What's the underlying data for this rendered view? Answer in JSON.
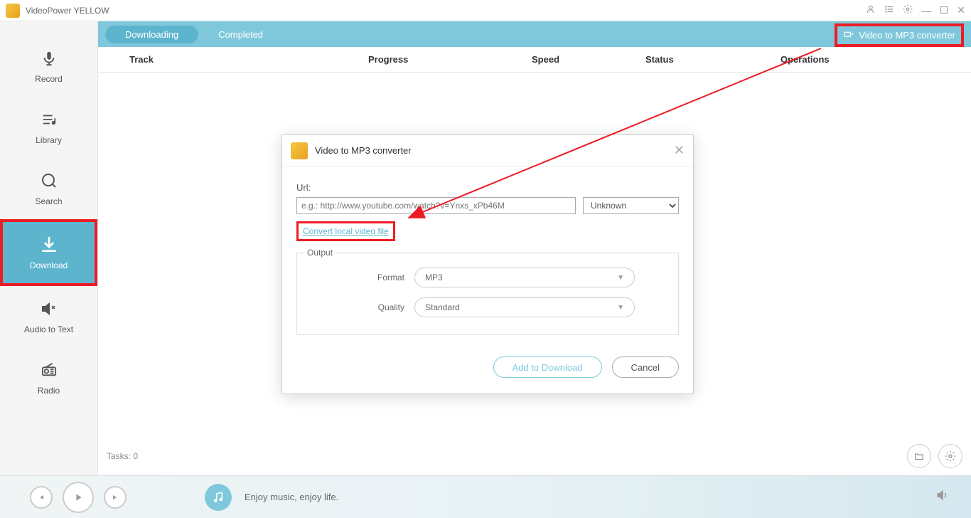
{
  "titlebar": {
    "title": "VideoPower YELLOW"
  },
  "sidebar": {
    "items": [
      {
        "label": "Record"
      },
      {
        "label": "Library"
      },
      {
        "label": "Search"
      },
      {
        "label": "Download"
      },
      {
        "label": "Audio to Text"
      },
      {
        "label": "Radio"
      }
    ]
  },
  "tabs": {
    "downloading": "Downloading",
    "completed": "Completed",
    "mp3converter": "Video to MP3 converter"
  },
  "table": {
    "headers": {
      "track": "Track",
      "progress": "Progress",
      "speed": "Speed",
      "status": "Status",
      "operations": "Operations"
    }
  },
  "tasks": {
    "label": "Tasks: 0"
  },
  "modal": {
    "title": "Video to MP3 converter",
    "urlLabel": "Url:",
    "urlPlaceholder": "e.g.: http://www.youtube.com/watch?v=Ynxs_xPb46M",
    "selectValue": "Unknown",
    "convertLink": "Convert local video file",
    "output": {
      "legend": "Output",
      "formatLabel": "Format",
      "formatValue": "MP3",
      "qualityLabel": "Quality",
      "qualityValue": "Standard"
    },
    "addBtn": "Add to Download",
    "cancelBtn": "Cancel"
  },
  "player": {
    "text": "Enjoy music, enjoy life."
  }
}
